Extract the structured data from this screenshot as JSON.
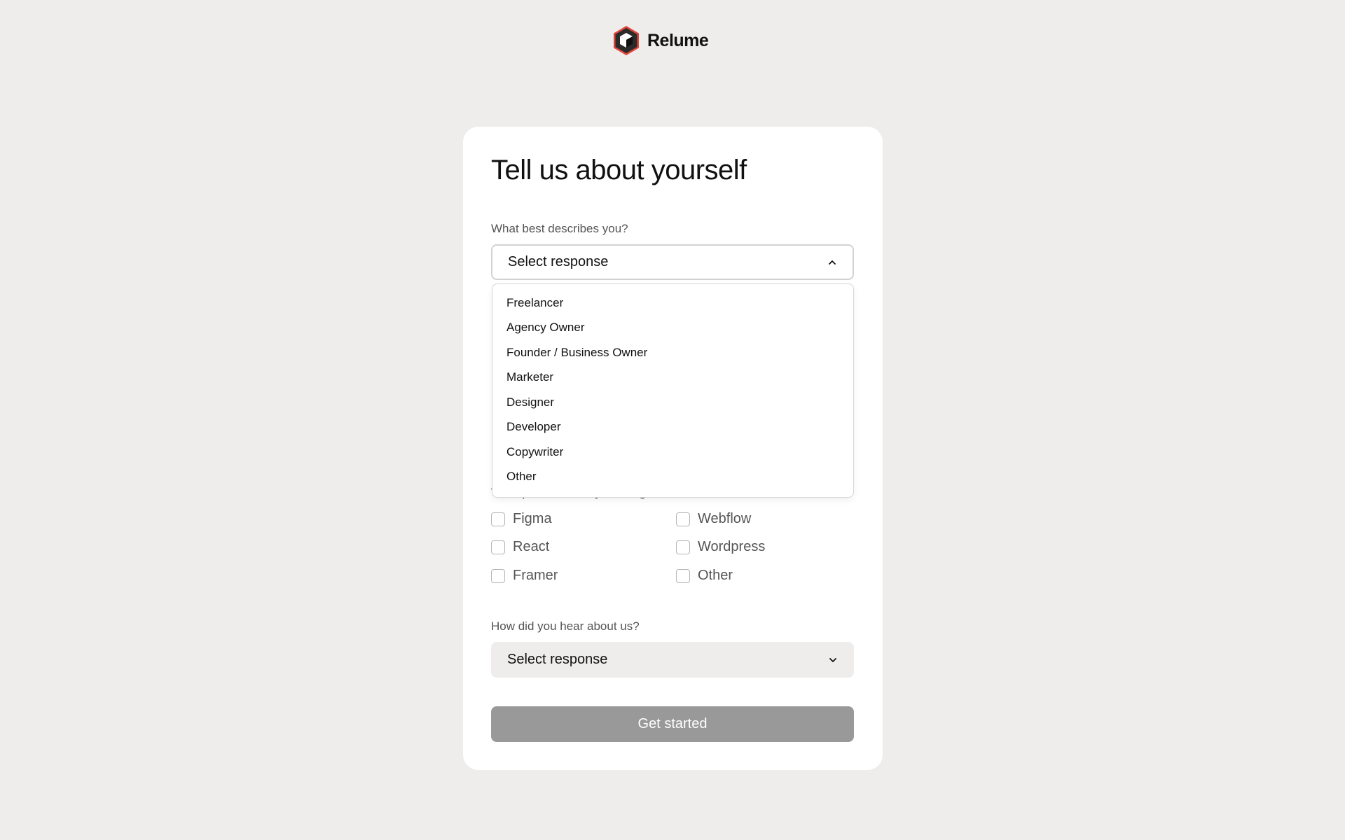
{
  "brand": {
    "name": "Relume",
    "logo_icon": "relume-logo-icon"
  },
  "card": {
    "title": "Tell us about yourself"
  },
  "role_field": {
    "label": "What best describes you?",
    "placeholder": "Select response",
    "state": "expanded",
    "chevron_icon": "chevron-up-icon",
    "options": [
      "Freelancer",
      "Agency Owner",
      "Founder / Business Owner",
      "Marketer",
      "Designer",
      "Developer",
      "Copywriter",
      "Other"
    ]
  },
  "platforms_field": {
    "label": "What platforms are you using with Relume?",
    "options": [
      {
        "label": "Figma",
        "checked": false
      },
      {
        "label": "Webflow",
        "checked": false
      },
      {
        "label": "React",
        "checked": false
      },
      {
        "label": "Wordpress",
        "checked": false
      },
      {
        "label": "Framer",
        "checked": false
      },
      {
        "label": "Other",
        "checked": false
      }
    ]
  },
  "source_field": {
    "label": "How did you hear about us?",
    "placeholder": "Select response",
    "state": "collapsed",
    "chevron_icon": "chevron-down-icon"
  },
  "submit": {
    "label": "Get started",
    "enabled": false
  },
  "colors": {
    "page_background": "#eeedeb",
    "card_background": "#ffffff",
    "disabled_button": "#999999",
    "logo_accent": "#e0453a"
  }
}
